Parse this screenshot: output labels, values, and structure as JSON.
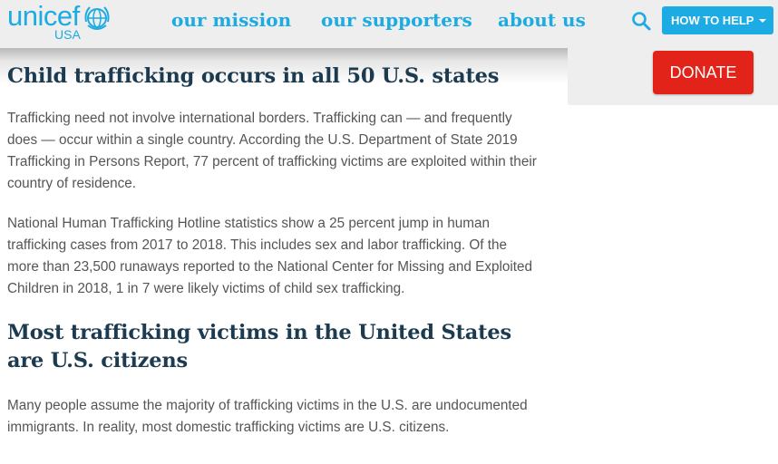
{
  "header": {
    "logo": {
      "wordmark": "unicef",
      "sub": "USA"
    },
    "nav": [
      {
        "label": "our mission"
      },
      {
        "label": "our supporters"
      },
      {
        "label": "about us"
      }
    ],
    "search_icon": "search-icon",
    "help_button": {
      "label": "HOW TO HELP"
    },
    "donate_button": {
      "label": "DONATE"
    }
  },
  "colors": {
    "brand_blue": "#1cabe2",
    "heading_navy": "#1c3b50",
    "donate_red": "#e2231a",
    "header_gray": "#eeeeee"
  },
  "article": {
    "heading_1": "Child trafficking occurs in all 50 U.S. states",
    "paragraph_1": "Trafficking need not involve international borders. Trafficking can — and frequently does — occur within a single country. According the U.S. Department of State 2019 Trafficking in Persons Report, 77 percent of trafficking victims are exploited within their country of residence.",
    "paragraph_2": "National Human Trafficking Hotline statistics show a 25 percent jump in human trafficking cases from 2017 to 2018. This includes sex and labor trafficking. Of the more than 23,500 runaways reported to the National Center for Missing and Exploited Children in 2018, 1 in 7 were likely victims of child sex trafficking.",
    "heading_2": "Most trafficking victims in the United States are U.S. citizens",
    "paragraph_3": "Many people assume the majority of trafficking victims in the U.S. are undocumented immigrants. In reality, most domestic trafficking victims are U.S. citizens."
  }
}
